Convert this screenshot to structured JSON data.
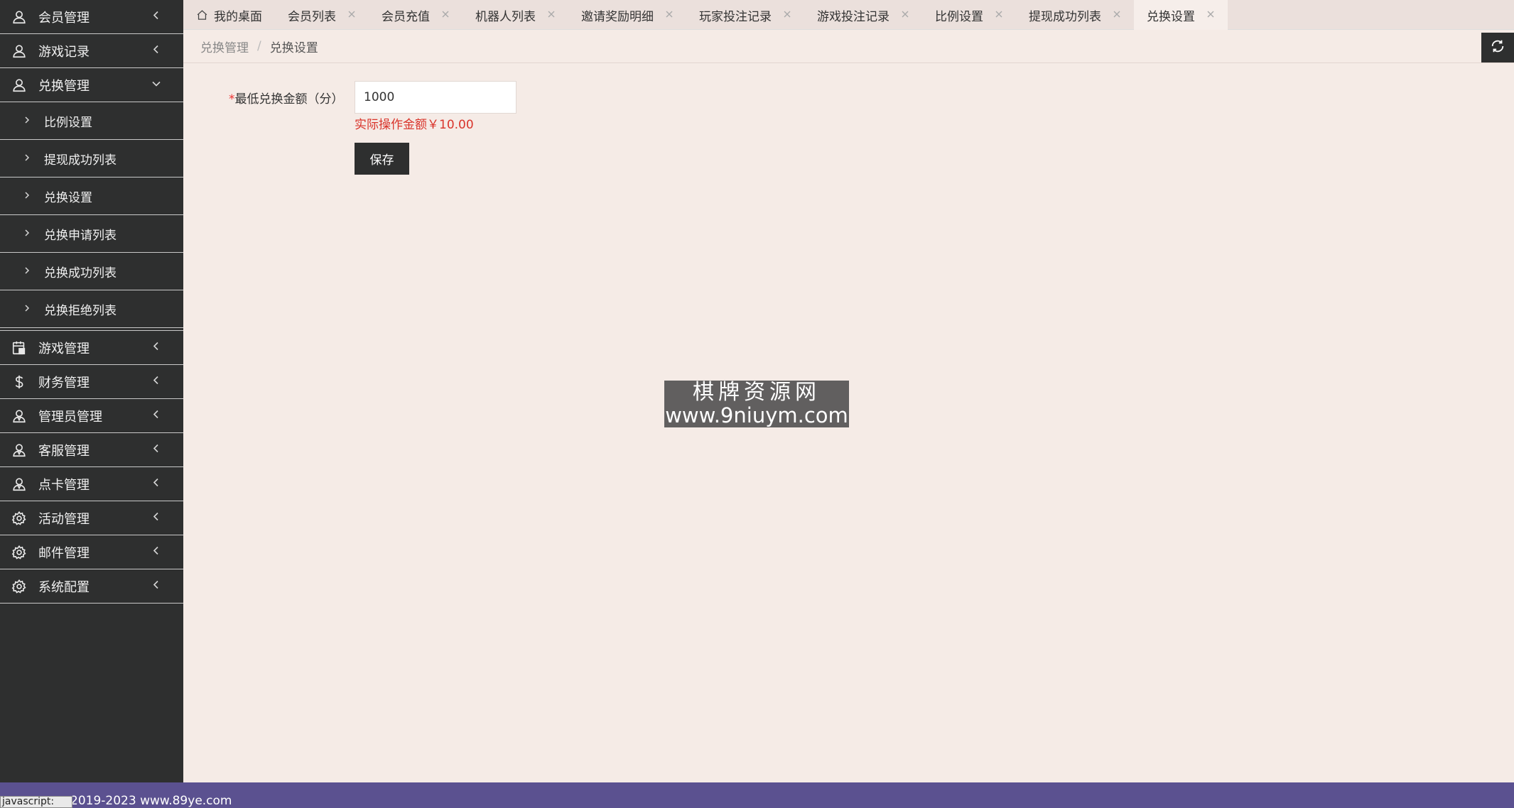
{
  "sidebar": {
    "menus": [
      {
        "label": "会员管理",
        "icon": "user-icon",
        "expanded": false
      },
      {
        "label": "游戏记录",
        "icon": "user-icon",
        "expanded": false
      },
      {
        "label": "兑换管理",
        "icon": "user-icon",
        "expanded": true
      }
    ],
    "submenu": [
      {
        "label": "比例设置"
      },
      {
        "label": "提现成功列表"
      },
      {
        "label": "兑换设置"
      },
      {
        "label": "兑换申请列表"
      },
      {
        "label": "兑换成功列表"
      },
      {
        "label": "兑换拒绝列表"
      }
    ],
    "menus_after": [
      {
        "label": "游戏管理",
        "icon": "calendar-icon"
      },
      {
        "label": "财务管理",
        "icon": "dollar-icon"
      },
      {
        "label": "管理员管理",
        "icon": "admin-icon"
      },
      {
        "label": "客服管理",
        "icon": "admin-icon"
      },
      {
        "label": "点卡管理",
        "icon": "admin-icon"
      },
      {
        "label": "活动管理",
        "icon": "gear-icon"
      },
      {
        "label": "邮件管理",
        "icon": "gear-icon"
      },
      {
        "label": "系统配置",
        "icon": "gear-icon"
      }
    ]
  },
  "tabs": [
    {
      "label": "我的桌面",
      "closable": false,
      "active": false
    },
    {
      "label": "会员列表",
      "closable": true,
      "active": false
    },
    {
      "label": "会员充值",
      "closable": true,
      "active": false
    },
    {
      "label": "机器人列表",
      "closable": true,
      "active": false
    },
    {
      "label": "邀请奖励明细",
      "closable": true,
      "active": false
    },
    {
      "label": "玩家投注记录",
      "closable": true,
      "active": false
    },
    {
      "label": "游戏投注记录",
      "closable": true,
      "active": false
    },
    {
      "label": "比例设置",
      "closable": true,
      "active": false
    },
    {
      "label": "提现成功列表",
      "closable": true,
      "active": false
    },
    {
      "label": "兑换设置",
      "closable": true,
      "active": true
    }
  ],
  "breadcrumb": {
    "parent": "兑换管理",
    "separator": "/",
    "current": "兑换设置"
  },
  "form": {
    "required_mark": "*",
    "label": "最低兑换金额（分）",
    "value": "1000",
    "hint": "实际操作金额￥10.00",
    "save_label": "保存"
  },
  "watermark": {
    "line1": "棋牌资源网",
    "line2": "www.9niuym.com"
  },
  "footer": {
    "text": "2019-2023 www.89ye.com",
    "badge": "javascript:"
  },
  "colors": {
    "sidebar_bg": "#2e2f2f",
    "page_bg": "#f5ebe6",
    "footer_bg": "#5b5190",
    "hint": "#d9342b"
  }
}
